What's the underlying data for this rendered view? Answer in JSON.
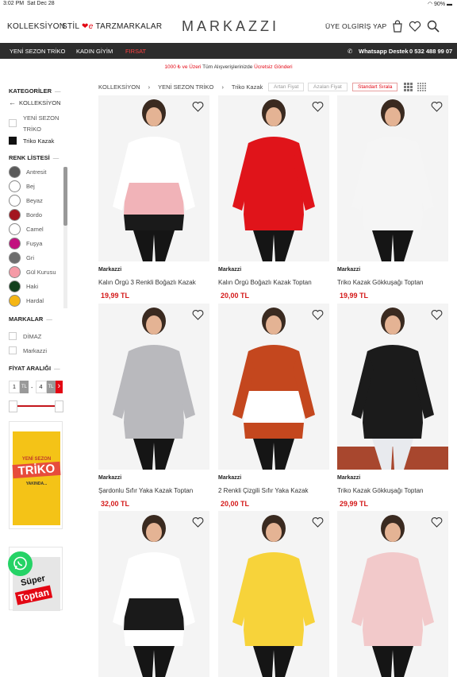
{
  "status": {
    "time": "3:02 PM",
    "date": "Sat Dec 28",
    "battery": "90%"
  },
  "nav": {
    "collections": "KOLLEKSİYON",
    "style_prefix": "STİL",
    "style_mid": "e",
    "style_suffix": "TARZ",
    "brands": "MARKALAR"
  },
  "logo": "MARKAZZI",
  "account": {
    "register": "ÜYE OL",
    "login": "GİRİŞ YAP"
  },
  "topbar": {
    "item1": "YENİ SEZON TRİKO",
    "item2": "KADIN GİYİM",
    "item3": "FIRSAT",
    "whatsapp_label": "Whatsapp Destek",
    "phone": "0 532 488 99 07"
  },
  "promo": {
    "part1": "1000 ₺ ve Üzeri",
    "part2": " Tüm Alışverişlerinizde ",
    "part3": "Ücretsiz Gönderi"
  },
  "sidebar": {
    "categories_title": "KATEGORİLER",
    "categories_root": "KOLLEKSİYON",
    "categories": [
      {
        "label": "YENİ SEZON TRİKO"
      },
      {
        "label": "Triko Kazak"
      }
    ],
    "colors_title": "RENK LİSTESİ",
    "colors": [
      {
        "label": "Antresit",
        "hex": "#5a5a5a"
      },
      {
        "label": "Bej",
        "hex": "#ffffff"
      },
      {
        "label": "Beyaz",
        "hex": "#ffffff"
      },
      {
        "label": "Bordo",
        "hex": "#a3141f"
      },
      {
        "label": "Camel",
        "hex": "#ffffff"
      },
      {
        "label": "Fuşya",
        "hex": "#c2127f"
      },
      {
        "label": "Gri",
        "hex": "#6e6e6e"
      },
      {
        "label": "Gül Kurusu",
        "hex": "#f59aa6"
      },
      {
        "label": "Haki",
        "hex": "#123f1c"
      },
      {
        "label": "Hardal",
        "hex": "#f5b614"
      }
    ],
    "brands_title": "MARKALAR",
    "brands": [
      {
        "label": "DİMAZ"
      },
      {
        "label": "Markazzi"
      }
    ],
    "price_title": "FİYAT ARALIĞI",
    "price_min": "1",
    "price_max": "4",
    "currency": "TL",
    "sep": "-",
    "go": "›",
    "banner1": {
      "line1": "YENİ SEZON",
      "line2": "TRİKO",
      "line3": "YAKINDA..."
    },
    "banner2": {
      "line1": "Süper",
      "line2": "Toptan"
    }
  },
  "breadcrumb": {
    "root": "KOLLEKSİYON",
    "level1": "YENİ SEZON TRİKO",
    "level2": "Triko Kazak",
    "sep": "›"
  },
  "sort": {
    "asc": "Artan Fiyat",
    "desc": "Azalan Fiyat",
    "default": "Standart Sırala"
  },
  "products": [
    {
      "brand": "Markazzi",
      "name": "Kalın Örgü 3 Renkli Boğazlı Kazak",
      "price": "19,99 TL"
    },
    {
      "brand": "Markazzi",
      "name": "Kalın Örgü Boğazlı Kazak Toptan",
      "price": "20,00 TL"
    },
    {
      "brand": "Markazzi",
      "name": "Triko Kazak Gökkuşağı Toptan",
      "price": "19,99 TL"
    },
    {
      "brand": "Markazzi",
      "name": "Şardonlu Sıfır Yaka Kazak Toptan",
      "price": "32,00 TL"
    },
    {
      "brand": "Markazzi",
      "name": "2 Renkli Çizgili Sıfır Yaka Kazak",
      "price": "20,00 TL"
    },
    {
      "brand": "Markazzi",
      "name": "Triko Kazak Gökkuşağı Toptan",
      "price": "29,99 TL"
    }
  ],
  "colors": {
    "accent": "#e30613",
    "price": "#d41a1a",
    "topbar": "#2d2d2d",
    "whatsapp": "#25d366"
  }
}
